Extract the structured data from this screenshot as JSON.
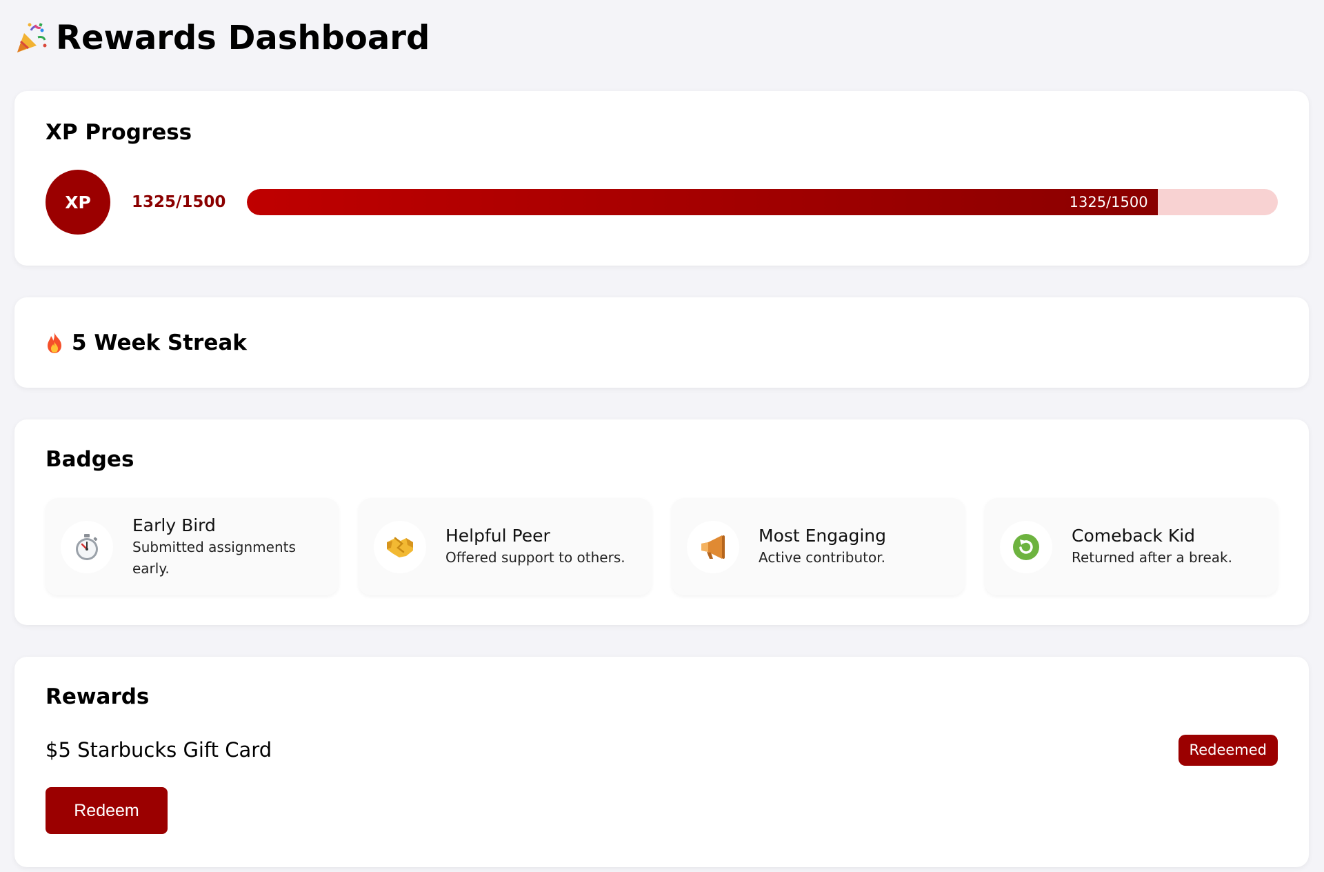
{
  "header": {
    "title": "Rewards Dashboard",
    "icon": "party-popper-icon"
  },
  "xp": {
    "heading": "XP Progress",
    "circle_label": "XP",
    "current": 1325,
    "goal": 1500,
    "value_text": "1325/1500",
    "bar_label": "1325/1500",
    "progress_fraction": 0.8833,
    "colors": {
      "fill_start": "#bf0000",
      "fill_end": "#8a0000",
      "track": "#f8d2d2",
      "accent": "#9b0000"
    }
  },
  "streak": {
    "icon": "fire-icon",
    "label": "5 Week Streak"
  },
  "badges": {
    "heading": "Badges",
    "items": [
      {
        "name": "Early Bird",
        "description": "Submitted assignments early.",
        "icon": "stopwatch-icon"
      },
      {
        "name": "Helpful Peer",
        "description": "Offered support to others.",
        "icon": "handshake-icon"
      },
      {
        "name": "Most Engaging",
        "description": "Active contributor.",
        "icon": "megaphone-icon"
      },
      {
        "name": "Comeback Kid",
        "description": "Returned after a break.",
        "icon": "refresh-icon"
      }
    ]
  },
  "rewards": {
    "heading": "Rewards",
    "items": [
      {
        "name": "$5 Starbucks Gift Card",
        "status": "Redeemed"
      }
    ],
    "redeem_label": "Redeem"
  }
}
